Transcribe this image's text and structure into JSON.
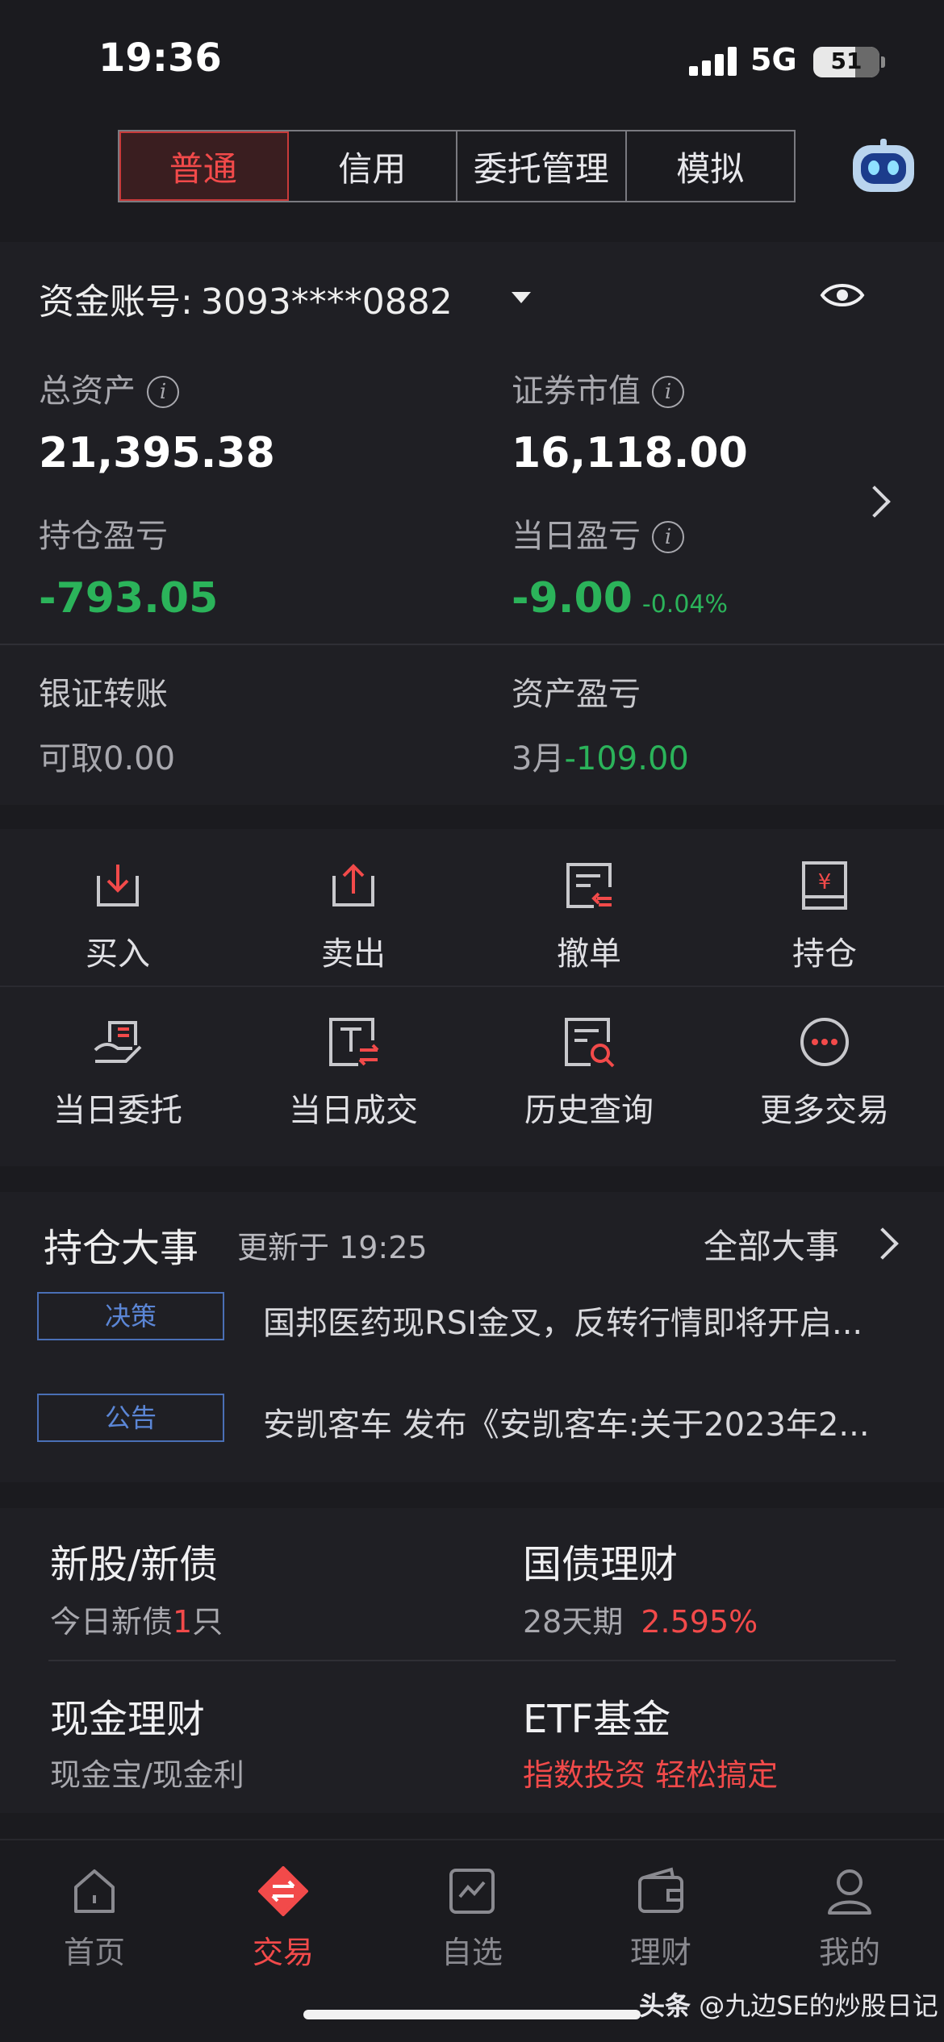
{
  "status": {
    "time": "19:36",
    "network": "5G",
    "battery": "51"
  },
  "tabs": [
    {
      "label": "普通",
      "active": true
    },
    {
      "label": "信用"
    },
    {
      "label": "委托管理"
    },
    {
      "label": "模拟"
    }
  ],
  "account": {
    "label": "资金账号:",
    "number": "3093****0882",
    "total_assets_label": "总资产",
    "total_assets": "21,395.38",
    "market_value_label": "证券市值",
    "market_value": "16,118.00",
    "position_pl_label": "持仓盈亏",
    "position_pl": "-793.05",
    "daily_pl_label": "当日盈亏",
    "daily_pl": "-9.00",
    "daily_pl_pct": "-0.04%",
    "transfer_label": "银证转账",
    "withdrawable": "可取0.00",
    "asset_pl_label": "资产盈亏",
    "asset_pl_month": "3月",
    "asset_pl_value": "-109.00"
  },
  "actions": [
    {
      "label": "买入"
    },
    {
      "label": "卖出"
    },
    {
      "label": "撤单"
    },
    {
      "label": "持仓"
    },
    {
      "label": "当日委托"
    },
    {
      "label": "当日成交"
    },
    {
      "label": "历史查询"
    },
    {
      "label": "更多交易"
    }
  ],
  "events": {
    "title": "持仓大事",
    "updated": "更新于 19:25",
    "all_label": "全部大事",
    "items": [
      {
        "tag": "决策",
        "text": "国邦医药现RSI金叉，反转行情即将开启..."
      },
      {
        "tag": "公告",
        "text": "安凯客车 发布《安凯客车:关于2023年2..."
      }
    ]
  },
  "products": {
    "ipo": {
      "title": "新股/新债",
      "sub_prefix": "今日新债",
      "count": "1",
      "sub_suffix": "只"
    },
    "bond": {
      "title": "国债理财",
      "period": "28天期",
      "rate": "2.595%"
    },
    "cash": {
      "title": "现金理财",
      "sub": "现金宝/现金利"
    },
    "etf": {
      "title": "ETF基金",
      "sub": "指数投资 轻松搞定"
    }
  },
  "nav": [
    {
      "label": "首页"
    },
    {
      "label": "交易",
      "active": true
    },
    {
      "label": "自选"
    },
    {
      "label": "理财"
    },
    {
      "label": "我的"
    }
  ],
  "watermark": {
    "brand": "头条",
    "handle": "@九边SE的炒股日记"
  },
  "colors": {
    "accent_red": "#f24a4a",
    "profit_green": "#2bb35a",
    "tag_blue": "#5b86d6",
    "background": "#1b1b1f"
  }
}
